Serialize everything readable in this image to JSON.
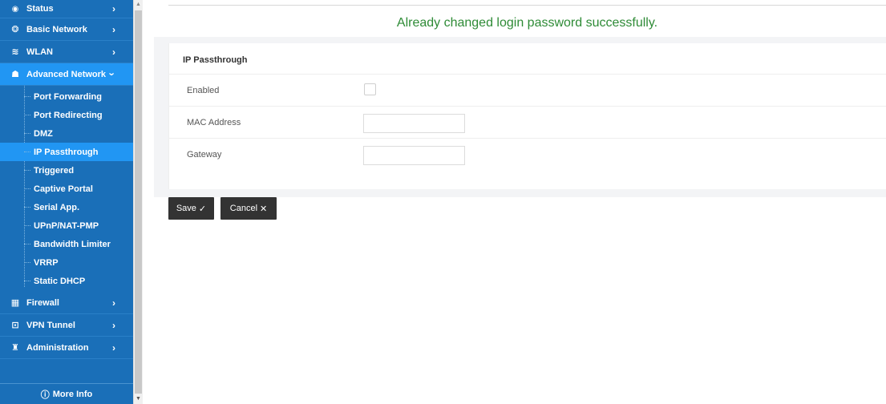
{
  "sidebar": {
    "top": {
      "label": "Status",
      "icon": "eye-icon"
    },
    "items": [
      {
        "label": "Basic Network",
        "icon": "globe-icon"
      },
      {
        "label": "WLAN",
        "icon": "wifi-icon"
      },
      {
        "label": "Advanced Network",
        "icon": "network-icon"
      }
    ],
    "advanced_sub": [
      "Port Forwarding",
      "Port Redirecting",
      "DMZ",
      "IP Passthrough",
      "Triggered",
      "Captive Portal",
      "Serial App.",
      "UPnP/NAT-PMP",
      "Bandwidth Limiter",
      "VRRP",
      "Static DHCP"
    ],
    "bottom_items": [
      {
        "label": "Firewall",
        "icon": "firewall-icon"
      },
      {
        "label": "VPN Tunnel",
        "icon": "vpn-icon"
      },
      {
        "label": "Administration",
        "icon": "admin-icon"
      }
    ],
    "more_info": "More Info",
    "active_item": "Advanced Network",
    "active_sub": "IP Passthrough",
    "accent": "#1a6fb8",
    "active_color": "#2196f3"
  },
  "message": "Already changed login password successfully.",
  "message_color": "#2e8b36",
  "form": {
    "title": "IP Passthrough",
    "enabled_label": "Enabled",
    "enabled_checked": false,
    "mac_label": "MAC Address",
    "mac_value": "",
    "gateway_label": "Gateway",
    "gateway_value": ""
  },
  "buttons": {
    "save": "Save",
    "save_glyph": "✓",
    "cancel": "Cancel",
    "cancel_glyph": "✕"
  }
}
